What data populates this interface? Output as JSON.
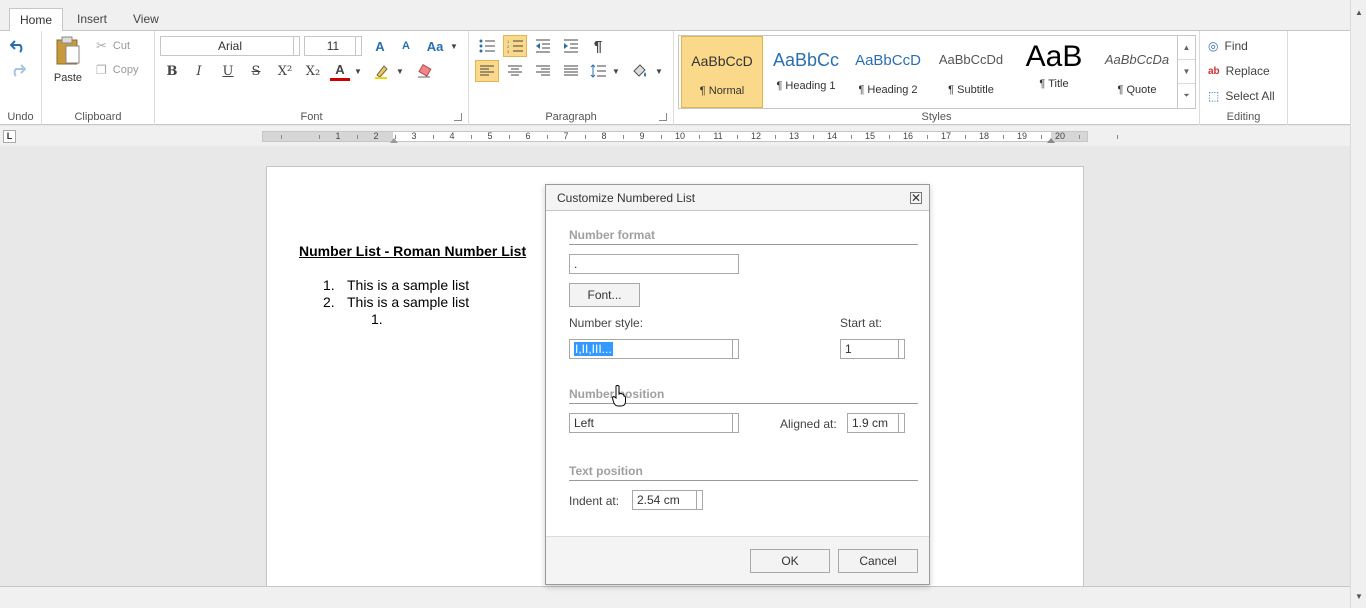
{
  "tabs": [
    {
      "label": "Home",
      "active": true
    },
    {
      "label": "Insert",
      "active": false
    },
    {
      "label": "View",
      "active": false
    }
  ],
  "ribbon": {
    "groups": {
      "undo": "Undo",
      "clipboard": "Clipboard",
      "font": "Font",
      "paragraph": "Paragraph",
      "styles": "Styles",
      "editing": "Editing"
    },
    "clipboard": {
      "paste": "Paste",
      "cut": "Cut",
      "copy": "Copy"
    },
    "font": {
      "family": "Arial",
      "size": "11",
      "grow": "A",
      "shrink": "A",
      "change_case": "Aa",
      "bold": "B",
      "italic": "I",
      "underline": "U",
      "strike": "S",
      "superscript": "X²",
      "subscript": "X₂",
      "font_color_letter": "A",
      "font_color": "#cc0000"
    },
    "styles": [
      {
        "sample": "AaBbCcD",
        "name": "¶ Normal",
        "selected": true
      },
      {
        "sample": "AaBbCc",
        "name": "¶ Heading 1",
        "selected": false
      },
      {
        "sample": "AaBbCcD",
        "name": "¶ Heading 2",
        "selected": false
      },
      {
        "sample": "AaBbCcDd",
        "name": "¶ Subtitle",
        "selected": false
      },
      {
        "sample": "AaB",
        "name": "¶ Title",
        "selected": false
      },
      {
        "sample": "AaBbCcDa",
        "name": "¶ Quote",
        "selected": false
      }
    ],
    "editing": {
      "find": "Find",
      "replace": "Replace",
      "select_all": "Select All"
    }
  },
  "ruler": {
    "corner": "L",
    "numbers": [
      "1",
      "2",
      "3",
      "4",
      "5",
      "6",
      "7",
      "8",
      "9",
      "10",
      "11",
      "12",
      "13",
      "14",
      "15",
      "16",
      "17",
      "18",
      "19",
      "20"
    ]
  },
  "document": {
    "title": "Number List - Roman Number List",
    "items": [
      {
        "marker": "1.",
        "text": "This is a sample list"
      },
      {
        "marker": "2.",
        "text": "This is a sample list"
      },
      {
        "marker": "1.",
        "text": ""
      }
    ]
  },
  "dialog": {
    "title": "Customize Numbered List",
    "close": "✕",
    "number_format": {
      "section": "Number format",
      "format_value": ".",
      "font_button": "Font...",
      "style_label": "Number style:",
      "style_value": "I,II,III...",
      "start_label": "Start at:",
      "start_value": "1"
    },
    "number_position": {
      "section": "Number position",
      "alignment_value": "Left",
      "aligned_label": "Aligned at:",
      "aligned_value": "1.9 cm"
    },
    "text_position": {
      "section": "Text position",
      "indent_label": "Indent at:",
      "indent_value": "2.54 cm"
    },
    "ok": "OK",
    "cancel": "Cancel"
  },
  "colors": {
    "accent_selected": "#fbd98a",
    "selection_highlight": "#3399ff",
    "section_title": "#a0a0a0"
  }
}
